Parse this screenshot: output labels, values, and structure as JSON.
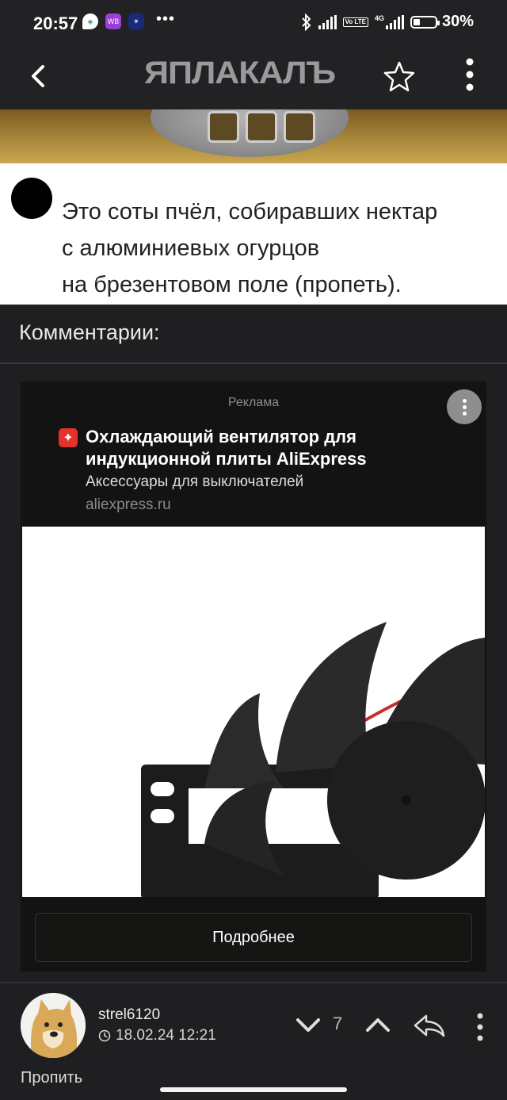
{
  "status_bar": {
    "time": "20:57",
    "app1": "◈",
    "app2": "WB",
    "app3": "✴",
    "more": "•••",
    "volte": "Vo LTE",
    "network": "4G",
    "battery": "30%",
    "battery_level": 0.3
  },
  "header": {
    "logo": "ЯПЛАКАЛЪ",
    "back_icon": "chevron-left",
    "favorite_icon": "star-outline",
    "menu_icon": "vertical-dots"
  },
  "meme": {
    "caption": "Это соты пчёл, собиравших нектар\nс алюминиевых огурцов\nна брезентовом поле (пропеть)."
  },
  "comments": {
    "title": "Комментарии:"
  },
  "ad": {
    "label": "Реклама",
    "title": "Охлаждающий вентилятор для индукционной плиты AliExpress",
    "subtitle": "Аксессуары для выключателей",
    "domain": "aliexpress.ru",
    "button": "Подробнее"
  },
  "comment": {
    "username": "strel6120",
    "date": "18.02.24 12:21",
    "votes": "7",
    "text_partial": "Пропить"
  },
  "colors": {
    "background": "#1f1f21",
    "ad_background": "#131313",
    "ali_red": "#e5312c"
  }
}
